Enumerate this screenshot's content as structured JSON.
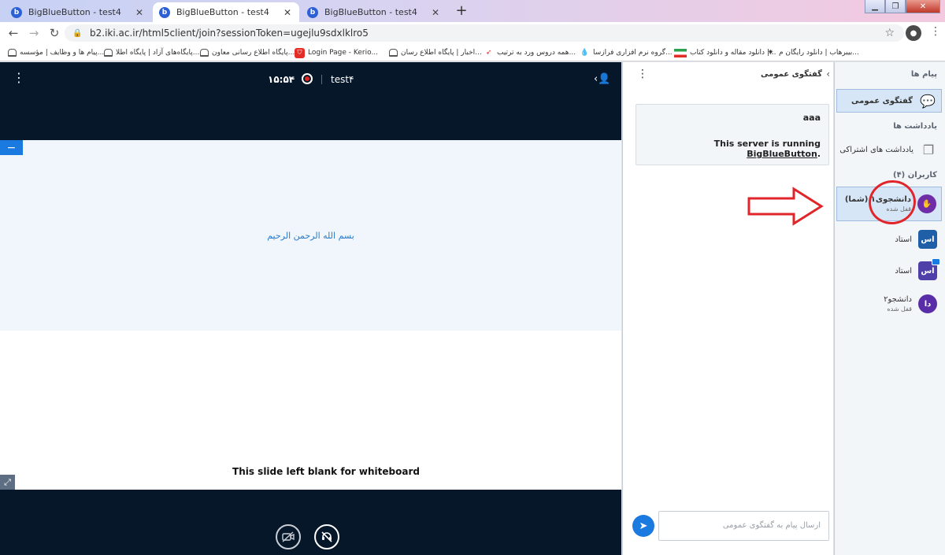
{
  "browser": {
    "tabs": [
      {
        "favicon": "b",
        "title": "BigBlueButton - test4"
      },
      {
        "favicon": "b",
        "title": "BigBlueButton - test4"
      },
      {
        "favicon": "b",
        "title": "BigBlueButton - test4"
      }
    ],
    "new_tab": "+",
    "url": "b2.iki.ac.ir/html5client/join?sessionToken=ugejlu9sdxlklro5",
    "bookmarks": [
      {
        "label": "بیبرهاب | دانلود رایگان م...",
        "icon": "tiny-icon"
      },
      {
        "label": "دانلود مقاله و دانلود کتاب |...",
        "icon": "flag-icon"
      },
      {
        "label": "گروه نرم افزاری فرازسا...",
        "icon": "drop-icon"
      },
      {
        "label": "همه دروس ورد به ترتیب...",
        "icon": "red-bird-icon"
      },
      {
        "label": "اخبار | پایگاه اطلاع رسان...",
        "icon": "house-icon"
      },
      {
        "label": "Login Page - Kerio...",
        "icon": "red-shield-icon"
      },
      {
        "label": "پایگاه اطلاع رسانی معاون...",
        "icon": "house-icon"
      },
      {
        "label": "پایگاه‌های آزاد | پایگاه اطلا...",
        "icon": "house-icon"
      },
      {
        "label": "پیام ها و وظایف | مؤسسه...",
        "icon": "house-icon"
      }
    ]
  },
  "media": {
    "room_name": "test۴",
    "timer": "۱۵:۵۴",
    "slide_text": "بسم الله الرحمن الرحیم",
    "slide_caption": "This slide left blank for whiteboard"
  },
  "chat": {
    "title": "گفتگوی عمومی",
    "welcome_line1": "aaa",
    "welcome_line2_prefix": "This server is running ",
    "welcome_link": "BigBlueButton",
    "welcome_line2_suffix": ".",
    "input_placeholder": "ارسال پیام به گفتگوی عمومی"
  },
  "userlist": {
    "messages_label": "پیام ها",
    "public_chat": "گفتگوی عمومی",
    "notes_label": "یادداشت ها",
    "shared_notes": "یادداشت های اشتراکی",
    "users_label": "کاربران (۴)",
    "users": [
      {
        "name": "دانشجوی۱ (شما)",
        "status": "قفل شده",
        "initials": "",
        "color": "#6f2da8"
      },
      {
        "name": "استاد",
        "status": "",
        "initials": "اس",
        "color": "#1f5fa8"
      },
      {
        "name": "استاد",
        "status": "",
        "initials": "اس",
        "color": "#4f3fa8"
      },
      {
        "name": "دانشجو۲",
        "status": "قفل شده",
        "initials": "دا",
        "color": "#5a2da8"
      }
    ]
  },
  "colors": {
    "accent": "#1b7ae0",
    "dark": "#06172a",
    "annotation": "#e0262a"
  }
}
